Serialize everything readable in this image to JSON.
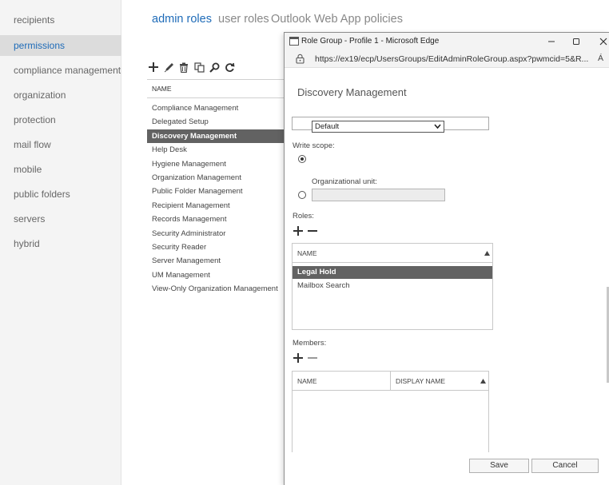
{
  "nav": {
    "items": [
      {
        "label": "recipients",
        "selected": false
      },
      {
        "label": "permissions",
        "selected": true
      },
      {
        "label": "compliance management",
        "selected": false
      },
      {
        "label": "organization",
        "selected": false
      },
      {
        "label": "protection",
        "selected": false
      },
      {
        "label": "mail flow",
        "selected": false
      },
      {
        "label": "mobile",
        "selected": false
      },
      {
        "label": "public folders",
        "selected": false
      },
      {
        "label": "servers",
        "selected": false
      },
      {
        "label": "hybrid",
        "selected": false
      }
    ]
  },
  "tabs": [
    {
      "label": "admin roles",
      "active": true
    },
    {
      "label": "user roles",
      "active": false
    },
    {
      "label": "Outlook Web App policies",
      "active": false
    }
  ],
  "toolbar": {
    "icons": [
      "add-icon",
      "edit-icon",
      "delete-icon",
      "copy-icon",
      "search-icon",
      "refresh-icon"
    ]
  },
  "roles_list": {
    "header": "NAME",
    "items": [
      "Compliance Management",
      "Delegated Setup",
      "Discovery Management",
      "Help Desk",
      "Hygiene Management",
      "Organization Management",
      "Public Folder Management",
      "Recipient Management",
      "Records Management",
      "Security Administrator",
      "Security Reader",
      "Server Management",
      "UM Management",
      "View-Only Organization Management"
    ],
    "selected_index": 2
  },
  "popup": {
    "window_title": "Role Group - Profile 1 - Microsoft Edge",
    "url": "https://ex19/ecp/UsersGroups/EditAdminRoleGroup.aspx?pwmcid=5&R...",
    "reader_label": "Á",
    "title": "Discovery Management",
    "write_scope": {
      "label": "Write scope:",
      "selected_value": "Default",
      "ou_label": "Organizational unit:",
      "ou_value": ""
    },
    "roles": {
      "label": "Roles:",
      "header": "NAME",
      "items": [
        "Legal Hold",
        "Mailbox Search"
      ],
      "selected_index": 0
    },
    "members": {
      "label": "Members:",
      "col_name": "NAME",
      "col_display": "DISPLAY NAME",
      "items": []
    },
    "save_label": "Save",
    "cancel_label": "Cancel"
  },
  "colors": {
    "accent": "#1e6bb8",
    "selected_row": "#626262",
    "nav_bg": "#f4f4f4"
  }
}
